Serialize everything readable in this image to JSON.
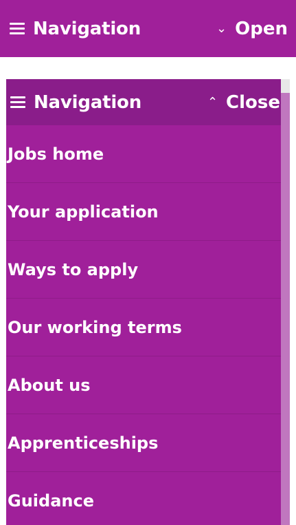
{
  "colors": {
    "nav_background": "#a0209a",
    "header_background": "#8a1d8a",
    "text": "#ffffff"
  },
  "collapsed_nav": {
    "title": "Navigation",
    "toggle_label": "Open",
    "toggle_icon": "chevron-down-icon"
  },
  "expanded_nav": {
    "title": "Navigation",
    "toggle_label": "Close",
    "toggle_icon": "chevron-up-icon",
    "items": [
      {
        "label": "Jobs home"
      },
      {
        "label": "Your application"
      },
      {
        "label": "Ways to apply"
      },
      {
        "label": "Our working terms"
      },
      {
        "label": "About us"
      },
      {
        "label": "Apprenticeships"
      },
      {
        "label": "Guidance"
      }
    ]
  }
}
